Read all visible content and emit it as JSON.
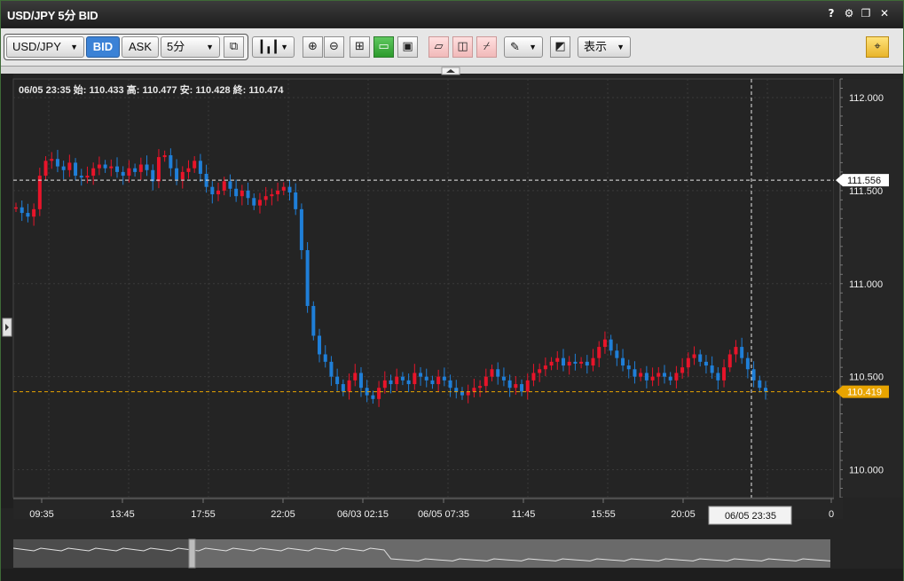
{
  "window": {
    "title": "USD/JPY 5分 BID"
  },
  "toolbar": {
    "symbol": "USD/JPY",
    "bid_label": "BID",
    "ask_label": "ASK",
    "interval": "5分",
    "display_label": "表示"
  },
  "ohlc": {
    "datetime": "06/05 23:35",
    "open_label": "始:",
    "open": "110.433",
    "high_label": "高:",
    "high": "110.477",
    "low_label": "安:",
    "low": "110.428",
    "close_label": "終:",
    "close": "110.474"
  },
  "crosshair": {
    "price_label": "111.556",
    "time_label": "06/05 23:35"
  },
  "current_price": {
    "label": "110.419",
    "color": "#e8a400"
  },
  "colors": {
    "up": "#e8142a",
    "down": "#1f7fd8",
    "accent_bid": "#3b82d6"
  },
  "chart_data": {
    "type": "line",
    "ylim": [
      109.85,
      112.1
    ],
    "y_ticks": [
      "112.000",
      "111.500",
      "111.000",
      "110.500",
      "110.000"
    ],
    "y_tick_values": [
      112.0,
      111.5,
      111.0,
      110.5,
      110.0
    ],
    "x_ticks": [
      "09:35",
      "13:45",
      "17:55",
      "22:05",
      "06/03 02:15",
      "06/05 07:35",
      "11:45",
      "15:55",
      "20:05",
      "0"
    ],
    "series": [
      {
        "values": [
          111.41,
          111.38,
          111.36,
          111.4,
          111.58,
          111.66,
          111.67,
          111.63,
          111.61,
          111.65,
          111.58,
          111.57,
          111.58,
          111.62,
          111.64,
          111.62,
          111.63,
          111.6,
          111.58,
          111.62,
          111.6,
          111.64,
          111.61,
          111.55,
          111.68,
          111.69,
          111.62,
          111.56,
          111.6,
          111.62,
          111.66,
          111.59,
          111.52,
          111.48,
          111.5,
          111.55,
          111.51,
          111.47,
          111.5,
          111.46,
          111.42,
          111.45,
          111.47,
          111.48,
          111.5,
          111.52,
          111.49,
          111.4,
          111.18,
          110.88,
          110.72,
          110.62,
          110.58,
          110.5,
          110.46,
          110.42,
          110.48,
          110.52,
          110.44,
          110.4,
          110.38,
          110.44,
          110.48,
          110.46,
          110.5,
          110.48,
          110.46,
          110.52,
          110.5,
          110.48,
          110.46,
          110.5,
          110.48,
          110.44,
          110.42,
          110.4,
          110.42,
          110.44,
          110.45,
          110.5,
          110.54,
          110.5,
          110.48,
          110.44,
          110.46,
          110.42,
          110.48,
          110.52,
          110.54,
          110.56,
          110.58,
          110.6,
          110.56,
          110.58,
          110.57,
          110.58,
          110.56,
          110.6,
          110.66,
          110.7,
          110.64,
          110.6,
          110.56,
          110.54,
          110.5,
          110.52,
          110.48,
          110.5,
          110.52,
          110.5,
          110.48,
          110.52,
          110.55,
          110.6,
          110.62,
          110.58,
          110.56,
          110.52,
          110.48,
          110.55,
          110.62,
          110.66,
          110.6,
          110.54,
          110.48,
          110.44,
          110.42
        ]
      }
    ]
  }
}
